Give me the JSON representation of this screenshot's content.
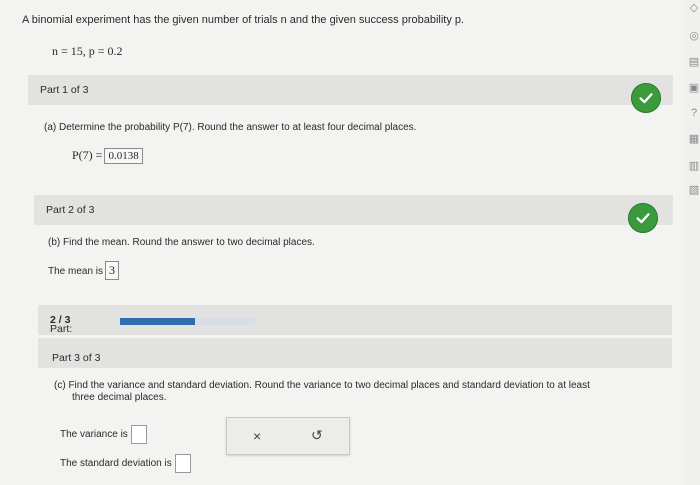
{
  "question": {
    "intro": "A binomial experiment has the given number of trials n and the given success probability p.",
    "params": "n = 15, p = 0.2"
  },
  "part1": {
    "header": "Part 1 of 3",
    "prompt": "(a) Determine the probability P(7). Round the answer to at least four decimal places.",
    "answer_label": "P(7) =",
    "answer_value": "0.0138"
  },
  "part2": {
    "header": "Part 2 of 3",
    "prompt": "(b) Find the mean. Round the answer to two decimal places.",
    "answer_label": "The mean is",
    "answer_value": "3"
  },
  "progress": {
    "label": "Part:",
    "value": "2 / 3",
    "fraction": 0.5556
  },
  "part3": {
    "header": "Part 3 of 3",
    "prompt_line1": "(c) Find the variance and standard deviation. Round the variance to two decimal places and standard deviation to at least",
    "prompt_line2": "three decimal places.",
    "variance_label": "The variance is",
    "sd_label": "The standard deviation is"
  },
  "toolbar": {
    "clear_symbol": "×",
    "undo_symbol": "↺"
  },
  "colors": {
    "check": "#3b9a3b",
    "progress": "#2f6fb0",
    "bar": "#e2e2e0"
  }
}
